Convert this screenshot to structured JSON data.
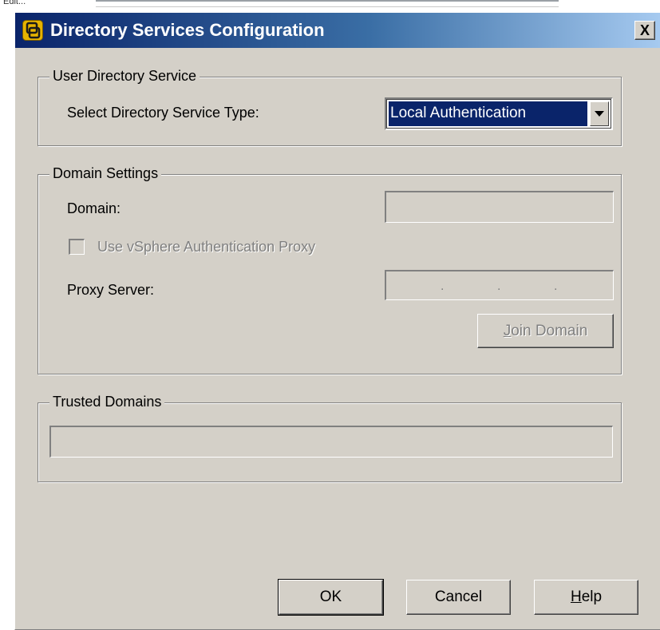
{
  "background": {
    "partial_text": "Edit..."
  },
  "dialog": {
    "title": "Directory Services Configuration",
    "close_label": "X",
    "title_icon": "vsphere-client-icon",
    "accent_color": "#0a246a"
  },
  "user_directory": {
    "legend": "User Directory Service",
    "type_label": "Select Directory Service Type:",
    "type_value": "Local Authentication",
    "arrow_icon": "dropdown-arrow-icon"
  },
  "domain_settings": {
    "legend": "Domain Settings",
    "domain_label": "Domain:",
    "domain_value": "",
    "proxy_checkbox_label": "Use vSphere Authentication Proxy",
    "proxy_checked": false,
    "proxy_server_label": "Proxy Server:",
    "ip_dots": [
      ".",
      ".",
      "."
    ],
    "join_button": {
      "mnemonic": "J",
      "rest": "oin Domain"
    }
  },
  "trusted_domains": {
    "legend": "Trusted Domains",
    "value": ""
  },
  "buttons": {
    "ok": "OK",
    "cancel": "Cancel",
    "help": {
      "mnemonic": "H",
      "rest": "elp"
    }
  }
}
